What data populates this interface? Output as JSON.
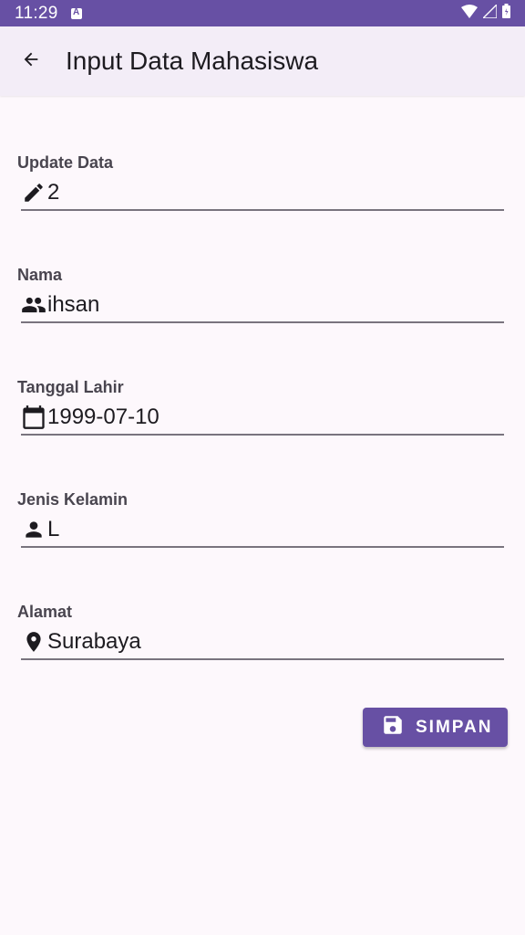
{
  "status_bar": {
    "time": "11:29",
    "icons": [
      "keyboard-notification-icon",
      "wifi-icon",
      "signal-icon",
      "battery-icon"
    ]
  },
  "app_bar": {
    "title": "Input Data Mahasiswa",
    "back_icon": "arrow-back-icon"
  },
  "form": {
    "fields": [
      {
        "label": "Update Data",
        "value": "2",
        "icon": "edit-icon"
      },
      {
        "label": "Nama",
        "value": "ihsan",
        "icon": "people-icon"
      },
      {
        "label": "Tanggal Lahir",
        "value": "1999-07-10",
        "icon": "calendar-icon"
      },
      {
        "label": "Jenis Kelamin",
        "value": "L",
        "icon": "person-icon"
      },
      {
        "label": "Alamat",
        "value": "Surabaya",
        "icon": "location-pin-icon"
      }
    ],
    "save_button": {
      "label": "SIMPAN",
      "icon": "save-icon"
    }
  },
  "colors": {
    "primary": "#6750a4",
    "background": "#fdf8fc",
    "app_bar": "#f3edf7",
    "underline": "#79747e"
  }
}
